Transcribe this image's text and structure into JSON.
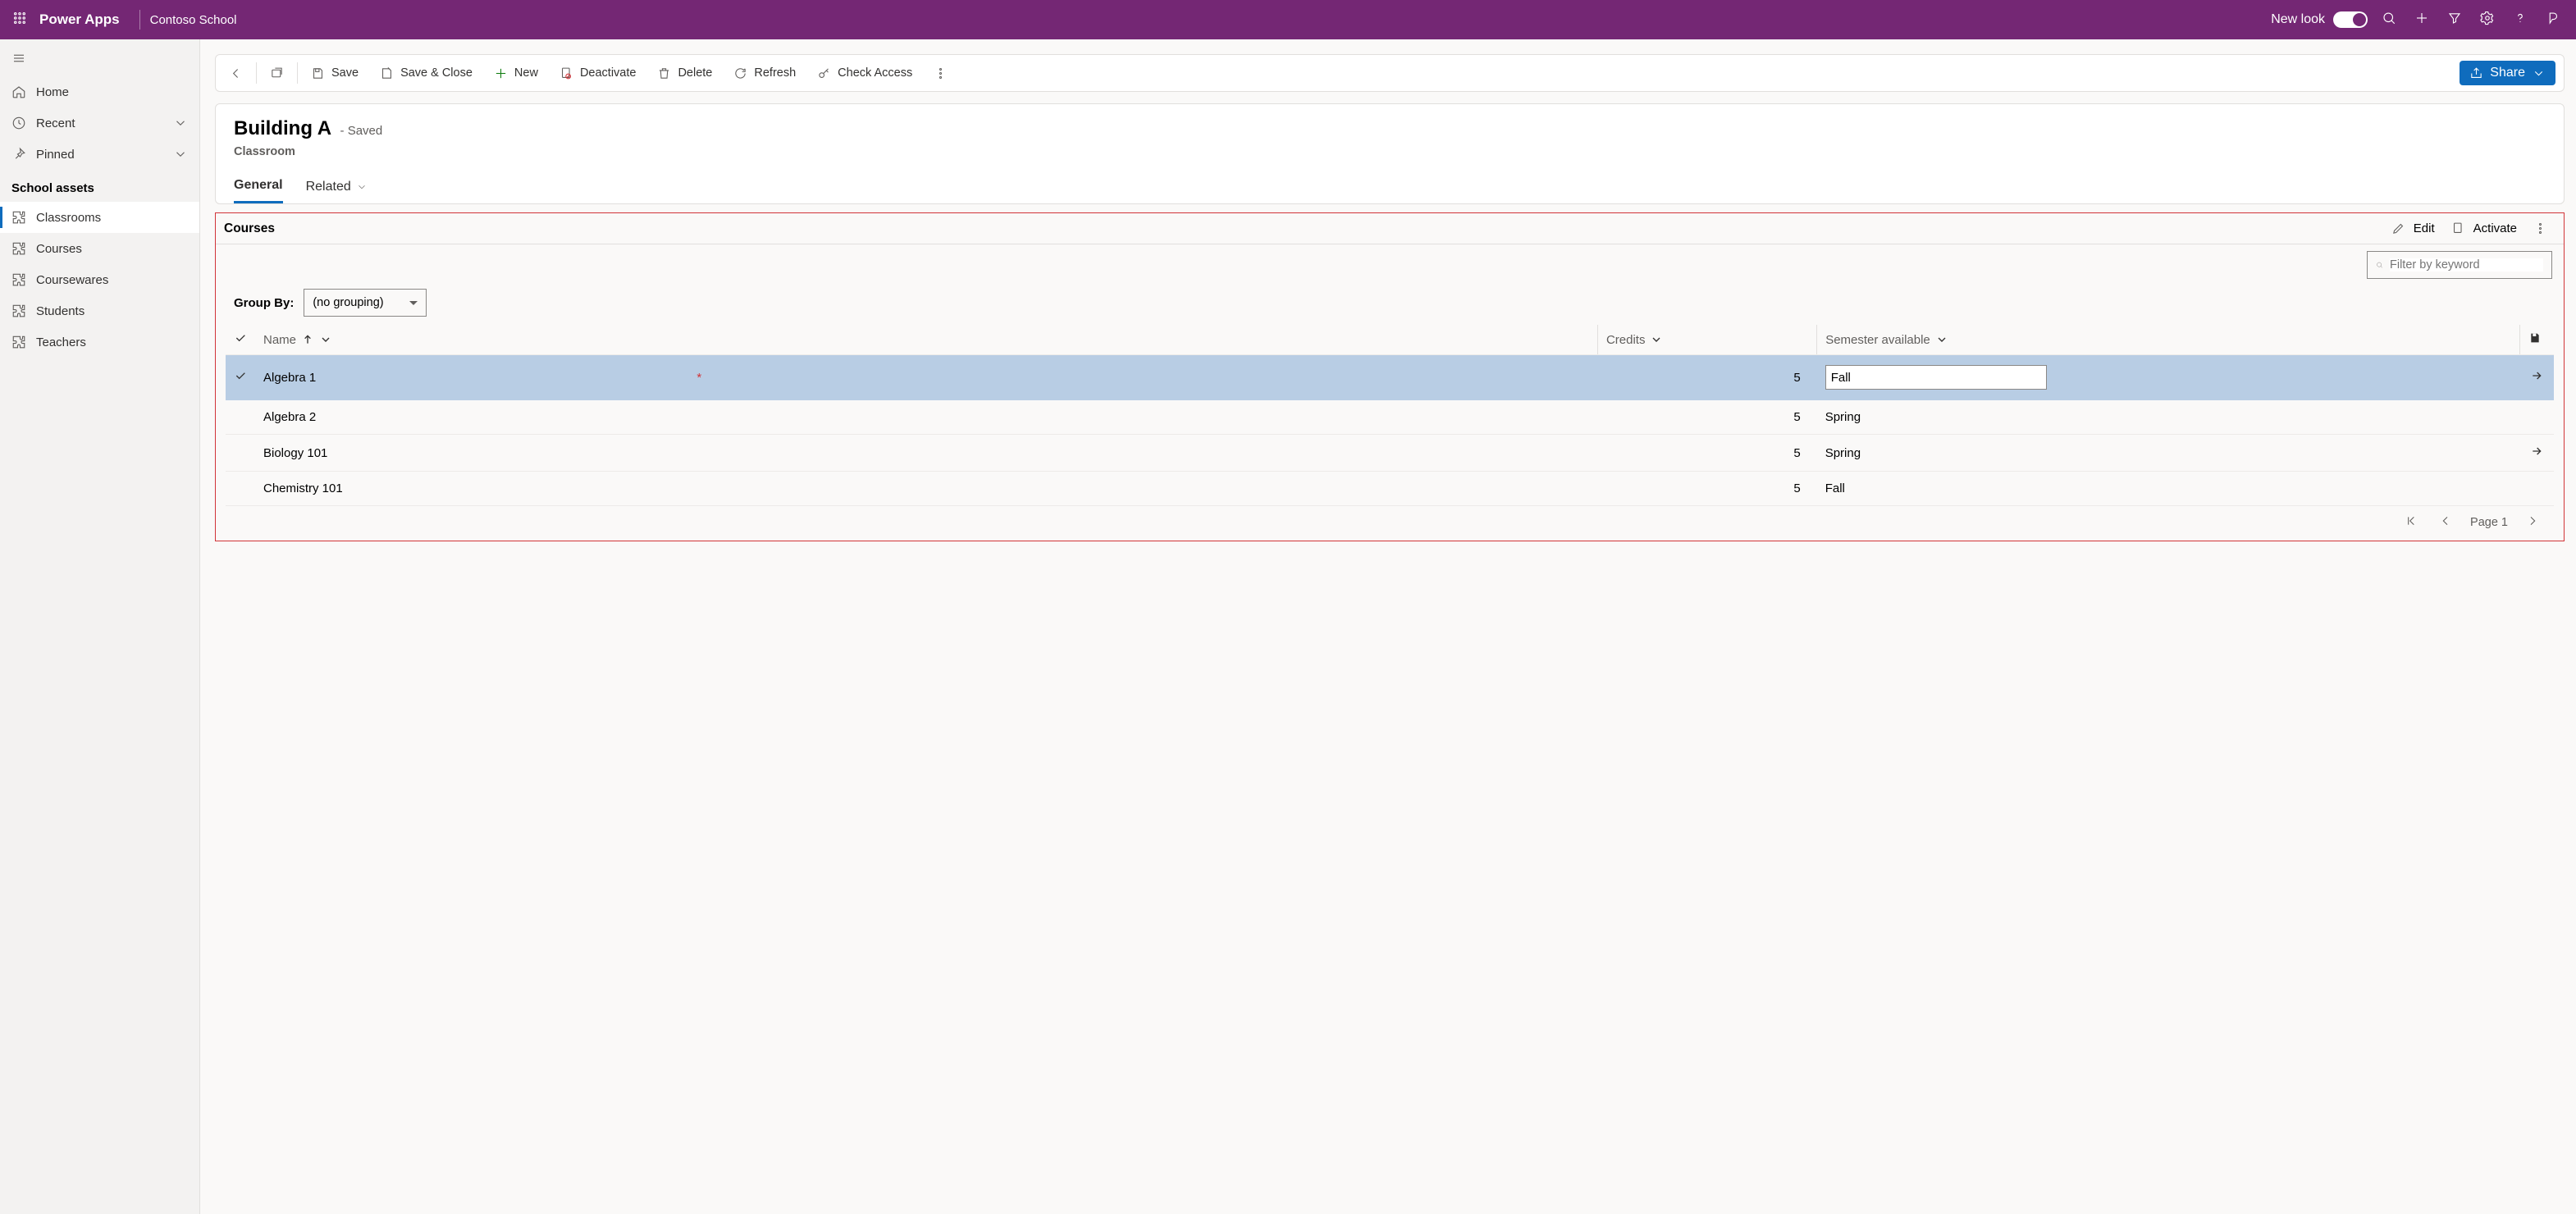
{
  "header": {
    "brand": "Power Apps",
    "app": "Contoso School",
    "new_look_label": "New look"
  },
  "nav": {
    "home": "Home",
    "recent": "Recent",
    "pinned": "Pinned",
    "group_title": "School assets",
    "items": {
      "classrooms": "Classrooms",
      "courses": "Courses",
      "coursewares": "Coursewares",
      "students": "Students",
      "teachers": "Teachers"
    }
  },
  "cmdbar": {
    "save": "Save",
    "save_close": "Save & Close",
    "new": "New",
    "deactivate": "Deactivate",
    "delete": "Delete",
    "refresh": "Refresh",
    "check_access": "Check Access",
    "share": "Share"
  },
  "form": {
    "title": "Building A",
    "saved_suffix": "- Saved",
    "entity": "Classroom",
    "tabs": {
      "general": "General",
      "related": "Related"
    }
  },
  "subgrid": {
    "title": "Courses",
    "edit": "Edit",
    "activate": "Activate",
    "filter_placeholder": "Filter by keyword",
    "group_by_label": "Group By:",
    "group_by_value": "(no grouping)",
    "columns": {
      "name": "Name",
      "credits": "Credits",
      "semester": "Semester available"
    },
    "rows": [
      {
        "name": "Algebra 1",
        "credits": "5",
        "semester": "Fall",
        "selected": true,
        "editing_semester": true,
        "arrow": true
      },
      {
        "name": "Algebra 2",
        "credits": "5",
        "semester": "Spring",
        "selected": false,
        "editing_semester": false,
        "arrow": false
      },
      {
        "name": "Biology 101",
        "credits": "5",
        "semester": "Spring",
        "selected": false,
        "editing_semester": false,
        "arrow": true
      },
      {
        "name": "Chemistry 101",
        "credits": "5",
        "semester": "Fall",
        "selected": false,
        "editing_semester": false,
        "arrow": false
      }
    ],
    "page_label": "Page 1"
  }
}
